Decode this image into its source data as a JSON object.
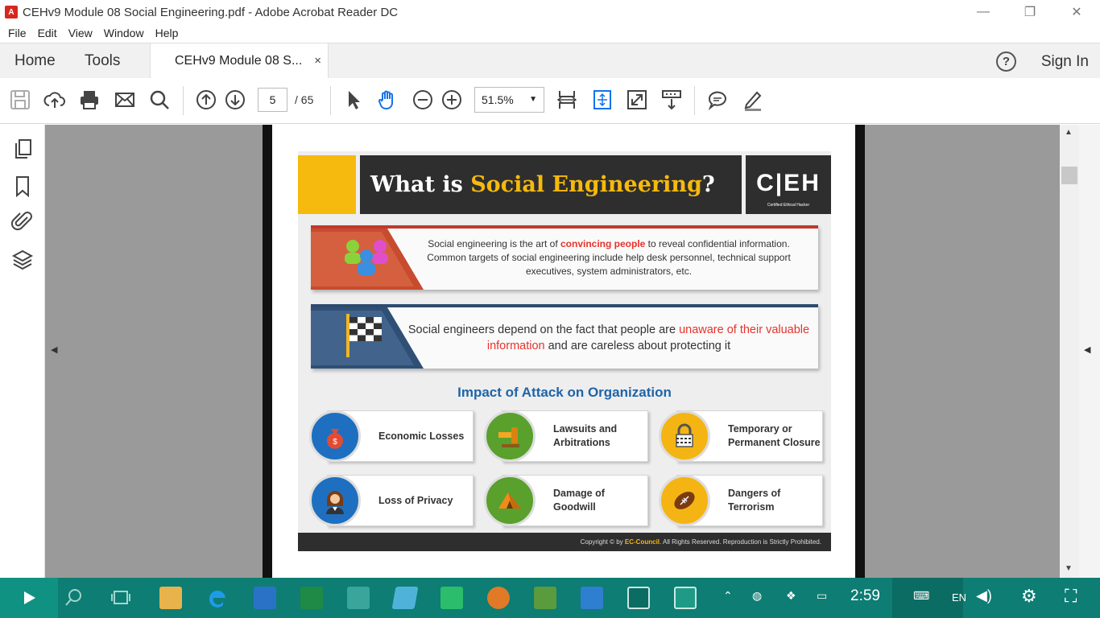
{
  "window": {
    "title": "CEHv9 Module 08 Social Engineering.pdf - Adobe Acrobat Reader DC",
    "minimize": "—",
    "restore": "❐",
    "close": "✕"
  },
  "menu": [
    "File",
    "Edit",
    "View",
    "Window",
    "Help"
  ],
  "tabs": {
    "home": "Home",
    "tools": "Tools",
    "document": "CEHv9 Module 08 S...",
    "document_close": "×",
    "help": "?",
    "sign_in": "Sign In"
  },
  "toolbar": {
    "page_current": "5",
    "page_total": "/   65",
    "zoom": "51.5%",
    "zoom_arrow": "▼"
  },
  "side": {
    "left_arrow": "◀",
    "right_arrow": "◀",
    "scroll_up": "▲",
    "scroll_down": "▼"
  },
  "slide": {
    "title_prefix": "What is ",
    "title_accent": "Social Engineering",
    "title_suffix": "?",
    "logo": "C|EH",
    "logo_sub": "Certified   Ethical   Hacker",
    "card1": {
      "part1": "Social engineering is the art of ",
      "highlight": "convincing people",
      "part2": " to reveal confidential information. Common targets of social engineering include help desk personnel, technical support executives, system administrators, etc."
    },
    "card2": {
      "part1": "Social engineers depend on the fact that people are ",
      "highlight": "unaware of their valuable information",
      "part2": " and are careless about protecting it"
    },
    "impact_heading": "Impact of Attack on Organization",
    "impacts": [
      {
        "label": "Economic Losses",
        "color": "#1e6fc0"
      },
      {
        "label": "Lawsuits and Arbitrations",
        "color": "#5aa02c"
      },
      {
        "label": "Temporary or Permanent Closure",
        "color": "#f4b413"
      },
      {
        "label": "Loss of Privacy",
        "color": "#1e6fc0"
      },
      {
        "label": "Damage of Goodwill",
        "color": "#5aa02c"
      },
      {
        "label": "Dangers of Terrorism",
        "color": "#f4b413"
      }
    ],
    "footer_prefix": "Copyright © by ",
    "footer_brand": "EC-Council",
    "footer_suffix": ". All Rights Reserved. Reproduction is Strictly Prohibited."
  },
  "taskbar": {
    "clock": "2:59",
    "lang": "EN"
  }
}
